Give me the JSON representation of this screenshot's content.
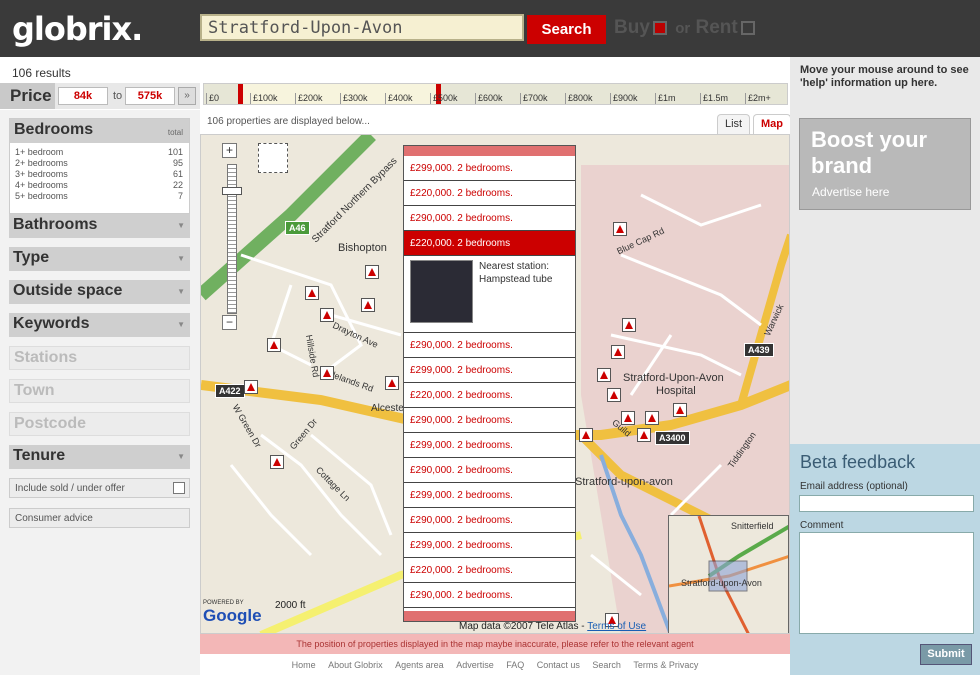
{
  "header": {
    "logo": "globrix.",
    "search_value": "Stratford-Upon-Avon",
    "search_label": "Search",
    "buy_label": "Buy",
    "or_label": "or",
    "rent_label": "Rent"
  },
  "results": {
    "count_text": "106 results"
  },
  "price": {
    "label": "Price",
    "min": "84k",
    "to": "to",
    "max": "575k",
    "go": "»"
  },
  "pricebar": {
    "ticks": [
      "£0",
      "£100k",
      "£200k",
      "£300k",
      "£400k",
      "£500k",
      "£600k",
      "£700k",
      "£800k",
      "£900k",
      "£1m",
      "£1.5m",
      "£2m+"
    ]
  },
  "bedrooms": {
    "title": "Bedrooms",
    "total_label": "total",
    "rows": [
      {
        "label": "1+ bedroom",
        "count": "101"
      },
      {
        "label": "2+ bedrooms",
        "count": "95"
      },
      {
        "label": "3+ bedrooms",
        "count": "61"
      },
      {
        "label": "4+ bedrooms",
        "count": "22"
      },
      {
        "label": "5+ bedrooms",
        "count": "7"
      }
    ]
  },
  "filters": [
    "Bathrooms",
    "Type",
    "Outside space",
    "Keywords"
  ],
  "disabled_filters": [
    "Stations",
    "Town",
    "Postcode"
  ],
  "tenure": "Tenure",
  "include_sold": "Include sold / under offer",
  "consumer_advice": "Consumer advice",
  "map_header": {
    "message": "106 properties are displayed below...",
    "tab_list": "List",
    "tab_map": "Map"
  },
  "listings_above": [
    "£299,000. 2 bedrooms.",
    "£220,000. 2 bedrooms.",
    "£290,000. 2 bedrooms."
  ],
  "selected_listing": "£220,000. 2 bedrooms",
  "selected_detail": {
    "station_label": "Nearest station:",
    "station_name": "Hampstead tube"
  },
  "listings_below": [
    "£290,000. 2 bedrooms.",
    "£299,000. 2 bedrooms.",
    "£220,000. 2 bedrooms.",
    "£290,000. 2 bedrooms.",
    "£299,000. 2 bedrooms.",
    "£290,000. 2 bedrooms.",
    "£299,000. 2 bedrooms.",
    "£290,000. 2 bedrooms.",
    "£299,000. 2 bedrooms.",
    "£220,000. 2 bedrooms.",
    "£290,000. 2 bedrooms."
  ],
  "map_labels": {
    "bishopton": "Bishopton",
    "stratford_bypass": "Stratford Northern Bypass",
    "hospital_line1": "Stratford-Upon-Avon",
    "hospital_line2": "Hospital",
    "stratford_town": "Stratford-upon-avon",
    "alcester": "Alcester",
    "drayton": "Drayton Ave",
    "blue_cap": "Blue Cap Rd",
    "a46": "A46",
    "a422": "A422",
    "a439": "A439",
    "a3400": "A3400",
    "hillside": "Hillside Rd",
    "w_green": "W Green Dr",
    "green_dr": "Green Dr",
    "cottage": "Cottage Ln",
    "sidelands": "Sidelands Rd",
    "guild": "Guild",
    "tiddington": "Tiddington",
    "warwick": "Warwick",
    "snitterfield": "Snitterfield",
    "mini_stratford": "Stratford-upon-Avon",
    "scale": "2000 ft",
    "map_data": "Map data ©2007 Tele Atlas -",
    "terms": "Terms of Use",
    "powered_by": "POWERED BY",
    "google": "Google"
  },
  "disclaimer": "The position of properties displayed in the map maybe inaccurate, please refer to the relevant agent",
  "footer_links": [
    "Home",
    "About Globrix",
    "Agents area",
    "Advertise",
    "FAQ",
    "Contact us",
    "Search",
    "Terms & Privacy"
  ],
  "right": {
    "help": "Move your mouse around to see 'help' information up here.",
    "boost_title": "Boost your brand",
    "advertise": "Advertise here"
  },
  "beta": {
    "title": "Beta feedback",
    "email_label": "Email address (optional)",
    "comment_label": "Comment",
    "submit": "Submit"
  },
  "colors": {
    "accent": "#cc0000",
    "header_bg": "#3a3a3a",
    "beta_bg": "#bcd7e3"
  }
}
